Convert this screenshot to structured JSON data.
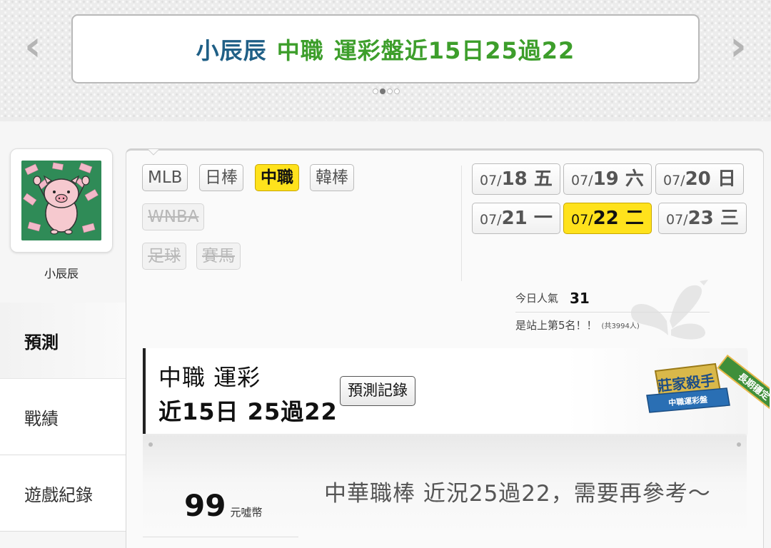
{
  "banner": {
    "author": "小辰辰",
    "league": "中職",
    "record": "運彩盤近15日25過22"
  },
  "user": {
    "name": "小辰辰"
  },
  "side_menu": [
    "預測",
    "戰績",
    "遊戲紀錄"
  ],
  "leagues": {
    "mlb": "MLB",
    "npb": "日棒",
    "cpbl": "中職",
    "kbo": "韓棒",
    "wnba": "WNBA",
    "soccer": "足球",
    "horse": "賽馬"
  },
  "dates": [
    {
      "md": "07/",
      "day": "18",
      "weekday": "五"
    },
    {
      "md": "07/",
      "day": "19",
      "weekday": "六"
    },
    {
      "md": "07/",
      "day": "20",
      "weekday": "日"
    },
    {
      "md": "07/",
      "day": "21",
      "weekday": "一"
    },
    {
      "md": "07/",
      "day": "22",
      "weekday": "二"
    },
    {
      "md": "07/",
      "day": "23",
      "weekday": "三"
    }
  ],
  "popularity": {
    "label": "今日人氣",
    "value": "31",
    "rank_text": "是站上第5名！！",
    "total": "(共3994人)"
  },
  "prediction": {
    "league_type": "中職 運彩",
    "record": "近15日 25過22",
    "record_button": "預測記錄"
  },
  "badges": {
    "ribbon": "長期穩定",
    "title": "莊家殺手",
    "subtitle": "中職運彩盤"
  },
  "content": {
    "price": "99",
    "unit": "元噓幣",
    "text": "中華職棒 近況25過22，需要再參考～"
  },
  "colors": {
    "accent_yellow": "#ffe21c",
    "author_blue": "#1f5f86",
    "record_green": "#3d9e2b"
  }
}
